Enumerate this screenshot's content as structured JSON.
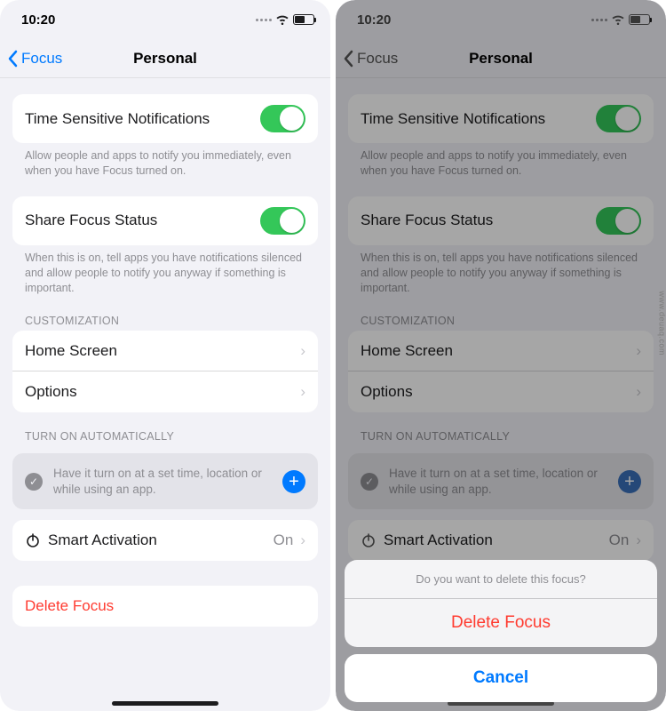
{
  "status": {
    "time": "10:20"
  },
  "nav": {
    "back": "Focus",
    "title": "Personal"
  },
  "timeSensitive": {
    "label": "Time Sensitive Notifications",
    "on": true,
    "footer": "Allow people and apps to notify you immediately, even when you have Focus turned on."
  },
  "shareStatus": {
    "label": "Share Focus Status",
    "on": true,
    "footer": "When this is on, tell apps you have notifications silenced and allow people to notify you anyway if something is important."
  },
  "sections": {
    "customization": "CUSTOMIZATION",
    "automation": "TURN ON AUTOMATICALLY"
  },
  "customization": {
    "home": "Home Screen",
    "options": "Options"
  },
  "automation": {
    "hint": "Have it turn on at a set time, location or while using an app.",
    "smart_label": "Smart Activation",
    "smart_value": "On"
  },
  "delete": {
    "label": "Delete Focus"
  },
  "sheet": {
    "message": "Do you want to delete this focus?",
    "destructive": "Delete Focus",
    "cancel": "Cancel"
  },
  "watermark": "www.deuaq.com"
}
